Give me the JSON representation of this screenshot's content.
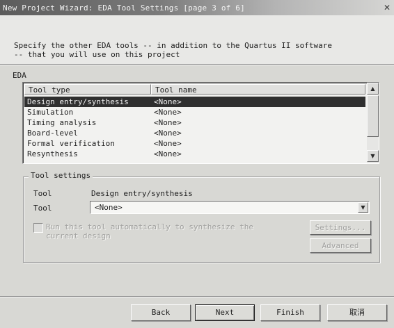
{
  "window": {
    "title": "New Project Wizard: EDA Tool Settings [page 3 of 6]",
    "close_glyph": "✕"
  },
  "header": {
    "description": "Specify the other EDA tools -- in addition to the Quartus II software\n-- that you will use on this project"
  },
  "eda": {
    "label": "EDA",
    "columns": [
      "Tool type",
      "Tool name"
    ],
    "rows": [
      {
        "type": "Design entry/synthesis",
        "name": "<None>",
        "selected": true
      },
      {
        "type": "Simulation",
        "name": "<None>"
      },
      {
        "type": "Timing analysis",
        "name": "<None>"
      },
      {
        "type": "Board-level",
        "name": "<None>"
      },
      {
        "type": "Formal verification",
        "name": "<None>"
      },
      {
        "type": "Resynthesis",
        "name": "<None>"
      }
    ],
    "scroll_up_icon": "▲",
    "scroll_down_icon": "▼"
  },
  "tool_settings": {
    "group_title": "Tool settings",
    "tool_label": "Tool",
    "tool_value": "Design entry/synthesis",
    "tool_select_label": "Tool",
    "tool_select_value": "<None>",
    "dropdown_icon": "▼",
    "run_checkbox_label": "Run this tool automatically to synthesize the\ncurrent design",
    "run_checkbox_checked": false,
    "settings_button": "Settings...",
    "advanced_button": "Advanced"
  },
  "footer": {
    "back_button": "Back",
    "next_button": "Next",
    "finish_button": "Finish",
    "cancel_button": "取消"
  }
}
